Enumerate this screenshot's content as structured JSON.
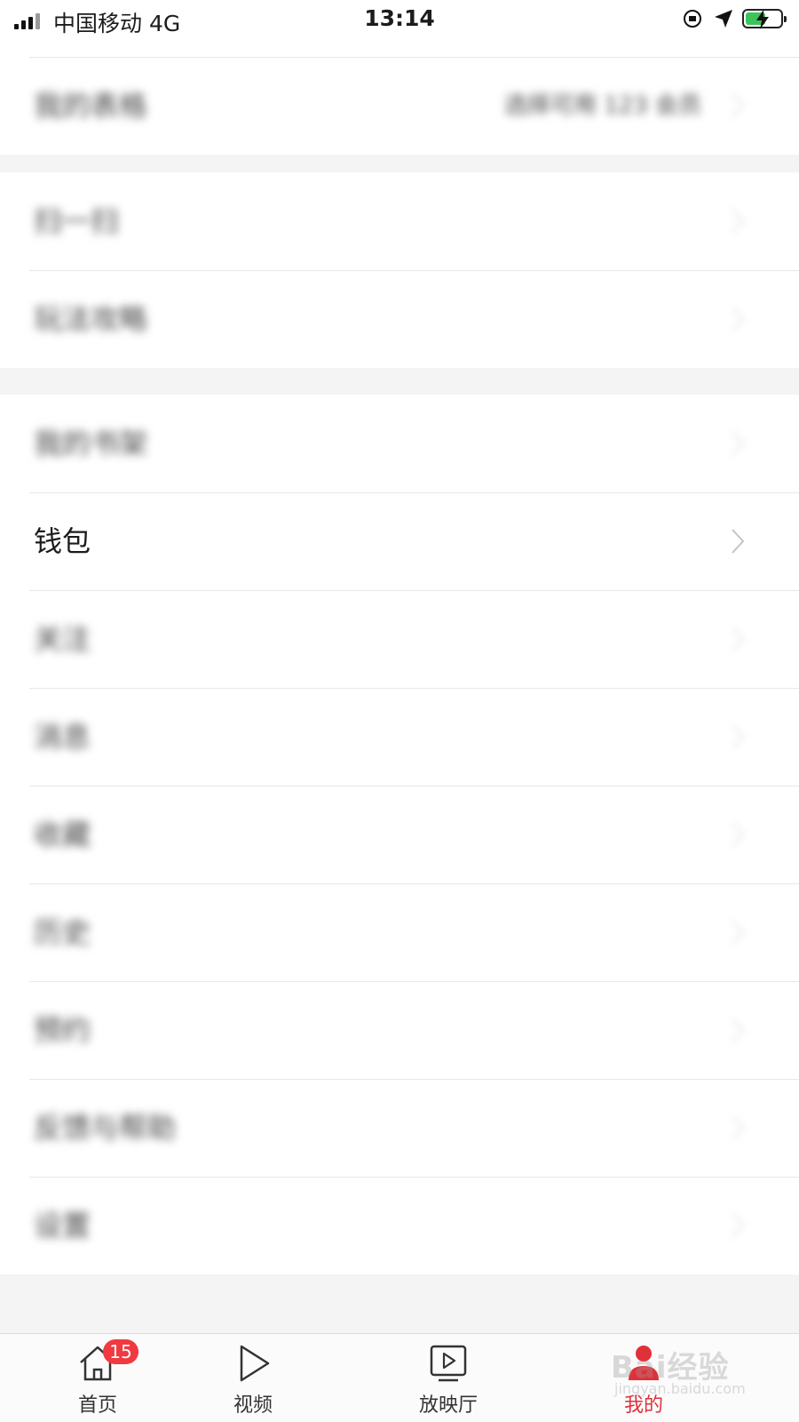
{
  "status_bar": {
    "carrier": "中国移动   4G",
    "time": "13:14"
  },
  "menu_groups": [
    {
      "rows": [
        {
          "label": "我的表格",
          "value": "选择可用 123 会员",
          "blurred": true
        }
      ]
    },
    {
      "rows": [
        {
          "label": "扫一扫",
          "blurred": true
        },
        {
          "label": "玩法攻略",
          "blurred": true
        }
      ]
    },
    {
      "rows": [
        {
          "label": "我的书架",
          "blurred": true
        },
        {
          "label": "钱包",
          "blurred": false
        },
        {
          "label": "关注",
          "blurred": true
        },
        {
          "label": "消息",
          "blurred": true
        },
        {
          "label": "收藏",
          "blurred": true
        },
        {
          "label": "历史",
          "blurred": true
        },
        {
          "label": "预约",
          "blurred": true
        },
        {
          "label": "反馈与帮助",
          "blurred": true
        },
        {
          "label": "设置",
          "blurred": true
        }
      ]
    }
  ],
  "tabbar": {
    "tabs": [
      {
        "label": "首页",
        "icon": "home-icon",
        "badge": "15",
        "active": false
      },
      {
        "label": "视频",
        "icon": "play-icon",
        "active": false
      },
      {
        "label": "放映厅",
        "icon": "screening-room-icon",
        "active": false
      },
      {
        "label": "我的",
        "icon": "profile-icon",
        "active": true
      }
    ],
    "watermark": {
      "main": "Bai经验",
      "sub": "jingyan.baidu.com"
    }
  },
  "colors": {
    "accent": "#e0313a",
    "badge": "#f03a40",
    "battery": "#3cc45a",
    "background": "#f4f4f5"
  }
}
